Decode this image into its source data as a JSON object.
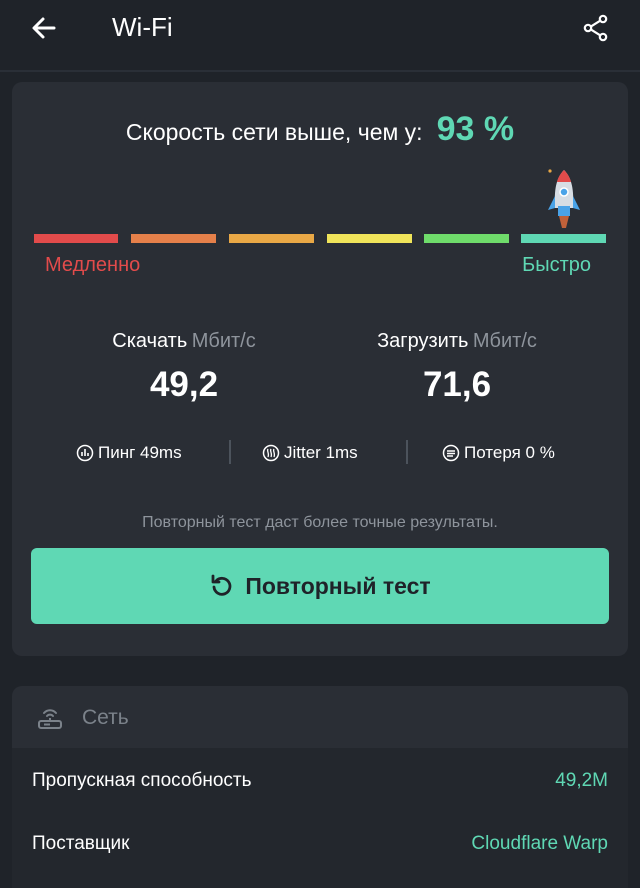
{
  "appbar": {
    "title": "Wi-Fi",
    "back_icon": "arrow-left-icon",
    "share_icon": "share-icon"
  },
  "result": {
    "headline": "Скорость сети выше, чем у:",
    "percent": "93 %",
    "speed_level": 0.93,
    "scale_slow": "Медленно",
    "scale_fast": "Быстро",
    "scale_colors": [
      "#e24b4b",
      "#e5804a",
      "#e9a846",
      "#f0e45a",
      "#6fdc6b",
      "#5fd8b4"
    ]
  },
  "download": {
    "label": "Скачать",
    "unit": "Мбит/с",
    "value": "49,2"
  },
  "upload": {
    "label": "Загрузить",
    "unit": "Мбит/с",
    "value": "71,6"
  },
  "stats": {
    "ping": "Пинг 49ms",
    "jitter": "Jitter 1ms",
    "loss": "Потеря 0 %"
  },
  "hint": "Повторный тест даст более точные результаты.",
  "retest": {
    "label": "Повторный тест",
    "icon": "refresh-icon"
  },
  "network": {
    "title": "Сеть",
    "icon": "router-icon",
    "rows": [
      {
        "label": "Пропускная способность",
        "value": "49,2M"
      },
      {
        "label": "Поставщик",
        "value": "Cloudflare Warp"
      }
    ]
  },
  "colors": {
    "accent": "#5fd8b4",
    "background": "#1f2329",
    "card": "#2a2e35",
    "slow": "#e24b4b"
  }
}
